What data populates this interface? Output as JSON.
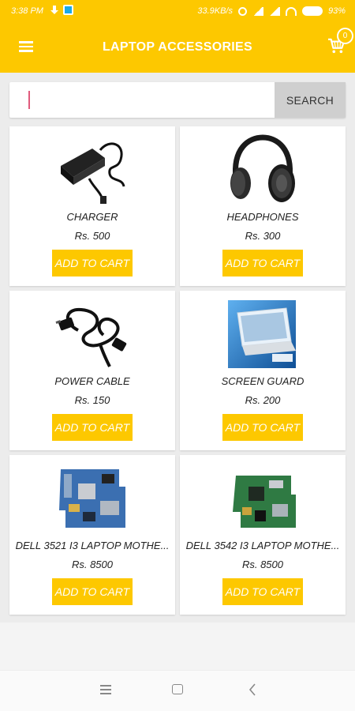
{
  "status_bar": {
    "time": "3:38 PM",
    "network_speed": "33.9KB/s",
    "battery": "93%"
  },
  "app_bar": {
    "title": "LAPTOP ACCESSORIES",
    "cart_count": "0"
  },
  "search": {
    "value": "",
    "button_label": "SEARCH"
  },
  "products": [
    {
      "name": "CHARGER",
      "price": "Rs. 500",
      "button_label": "ADD TO CART",
      "icon": "charger-image"
    },
    {
      "name": "HEADPHONES",
      "price": "Rs. 300",
      "button_label": "ADD TO CART",
      "icon": "headphones-image"
    },
    {
      "name": "POWER CABLE",
      "price": "Rs. 150",
      "button_label": "ADD TO CART",
      "icon": "power-cable-image"
    },
    {
      "name": "SCREEN GUARD",
      "price": "Rs. 200",
      "button_label": "ADD TO CART",
      "icon": "screen-guard-image"
    },
    {
      "name": "DELL 3521 I3 LAPTOP MOTHE...",
      "price": "Rs. 8500",
      "button_label": "ADD TO CART",
      "icon": "motherboard-image"
    },
    {
      "name": "DELL 3542 I3 LAPTOP MOTHE...",
      "price": "Rs. 8500",
      "button_label": "ADD TO CART",
      "icon": "motherboard-image"
    }
  ],
  "colors": {
    "accent": "#fdc800",
    "search_button": "#cfcfcf",
    "caret": "#e05a7c"
  }
}
